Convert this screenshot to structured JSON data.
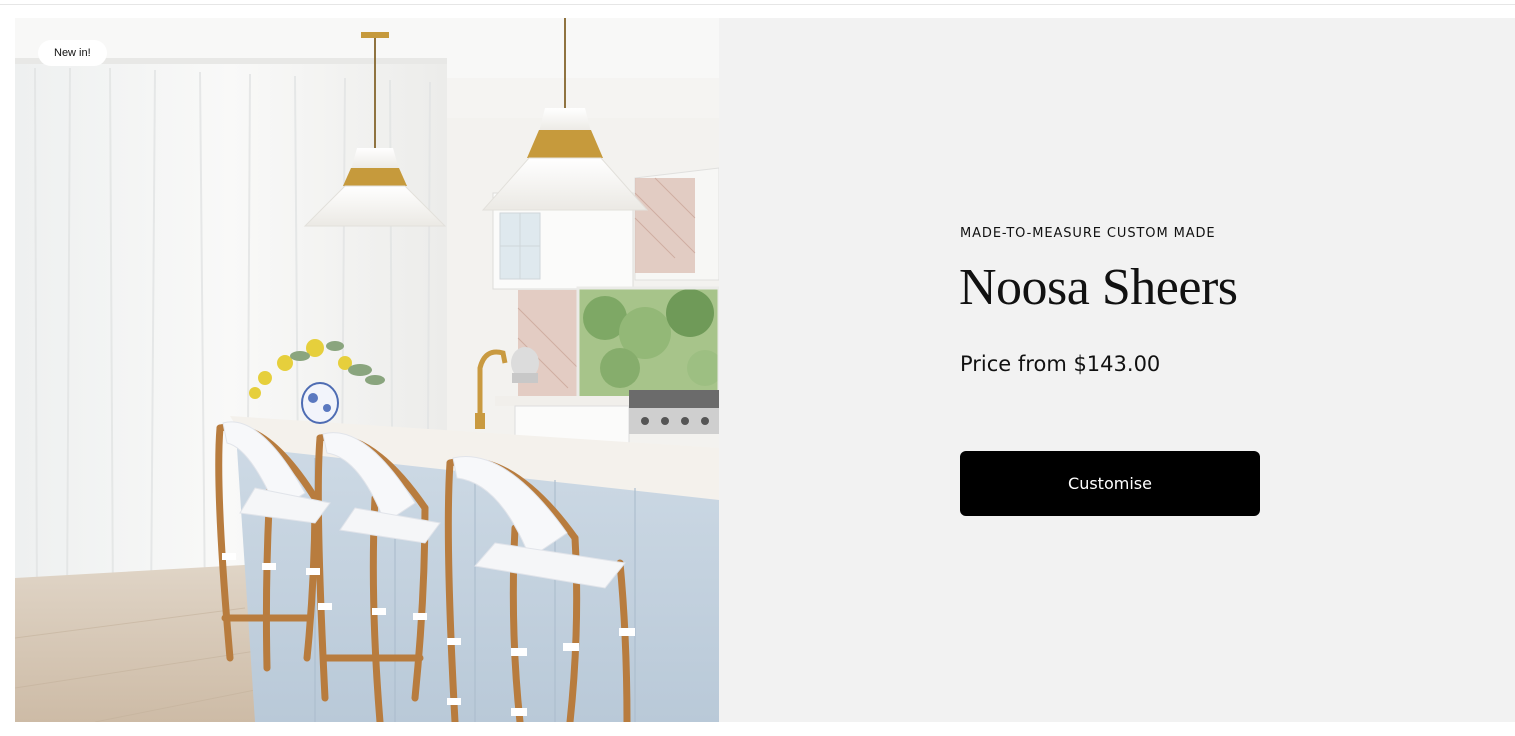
{
  "product": {
    "badge": "New in!",
    "eyebrow": "MADE-TO-MEASURE CUSTOM MADE",
    "title": "Noosa Sheers",
    "price": "Price from $143.00",
    "cta_label": "Customise",
    "image_alt": "Kitchen with white sheer curtains, two white and brass pendant lights, island bench and three rattan bar stools"
  },
  "colors": {
    "info_background": "#f2f2f2",
    "button_background": "#000000",
    "button_text": "#ffffff",
    "text": "#111111"
  }
}
